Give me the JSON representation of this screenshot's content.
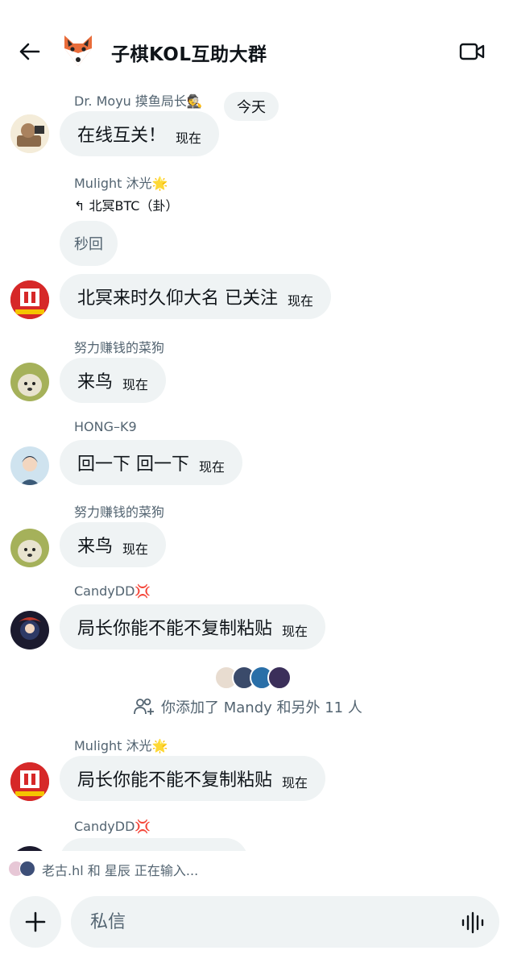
{
  "header": {
    "title": "子棋KOL互助大群"
  },
  "chat": {
    "date_chip": "今天",
    "messages": [
      {
        "sender": "Dr. Moyu 摸鱼局长🕵",
        "text": "在线互关！",
        "time": "现在"
      },
      {
        "sender": "Mulight 沐光🌟",
        "reply_to": "↰ 北冥BTC（卦）",
        "short_text": "秒回",
        "text": "北冥来时久仰大名 已关注",
        "time": "现在"
      },
      {
        "sender": "努力赚钱的菜狗",
        "text": "来鸟",
        "time": "现在"
      },
      {
        "sender": "HONG–K9",
        "text": "回一下 回一下",
        "time": "现在"
      },
      {
        "sender": "努力赚钱的菜狗",
        "text": "来鸟",
        "time": "现在"
      },
      {
        "sender": "CandyDD💢",
        "text": "局长你能不能不复制粘贴",
        "time": "现在"
      },
      {
        "sender": "Mulight 沐光🌟",
        "text": "局长你能不能不复制粘贴",
        "time": "现在"
      },
      {
        "sender": "CandyDD💢"
      }
    ],
    "system": {
      "text": "你添加了 Mandy 和另外 11 人"
    }
  },
  "typing": {
    "text": "老古.hl 和 星辰 正在输入..."
  },
  "composer": {
    "placeholder": "私信"
  },
  "colors": {
    "bubble": "#eff3f4",
    "secondary_text": "#536471",
    "primary_text": "#0f1419"
  }
}
